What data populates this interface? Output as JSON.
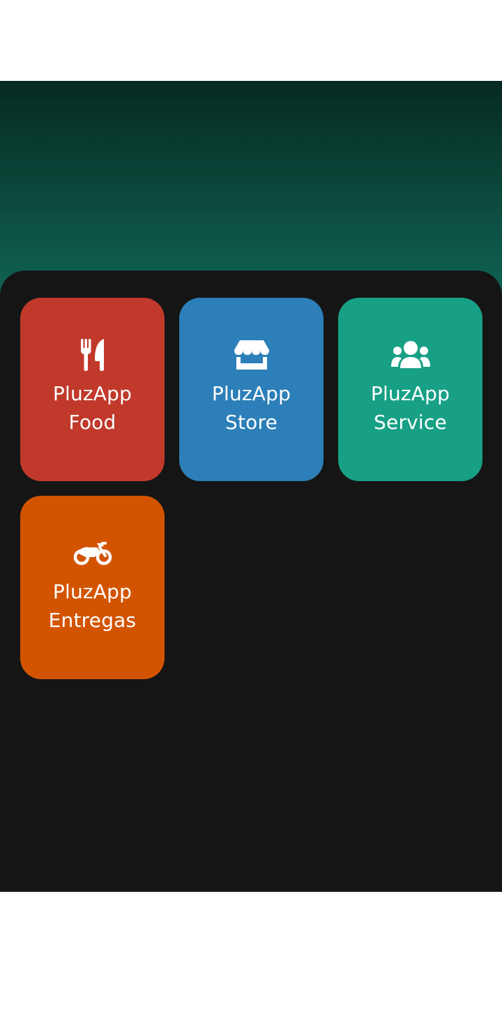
{
  "tiles": [
    {
      "id": "food",
      "line1": "PluzApp",
      "line2": "Food",
      "icon": "utensils-icon",
      "color": "#c0392b"
    },
    {
      "id": "store",
      "line1": "PluzApp",
      "line2": "Store",
      "icon": "store-icon",
      "color": "#2c7fb8"
    },
    {
      "id": "service",
      "line1": "PluzApp",
      "line2": "Service",
      "icon": "users-icon",
      "color": "#17a085"
    },
    {
      "id": "entregas",
      "line1": "PluzApp",
      "line2": "Entregas",
      "icon": "motorcycle-icon",
      "color": "#d35400"
    }
  ],
  "colors": {
    "hero_top": "#062a22",
    "hero_bottom": "#10614f",
    "panel": "#151515"
  }
}
